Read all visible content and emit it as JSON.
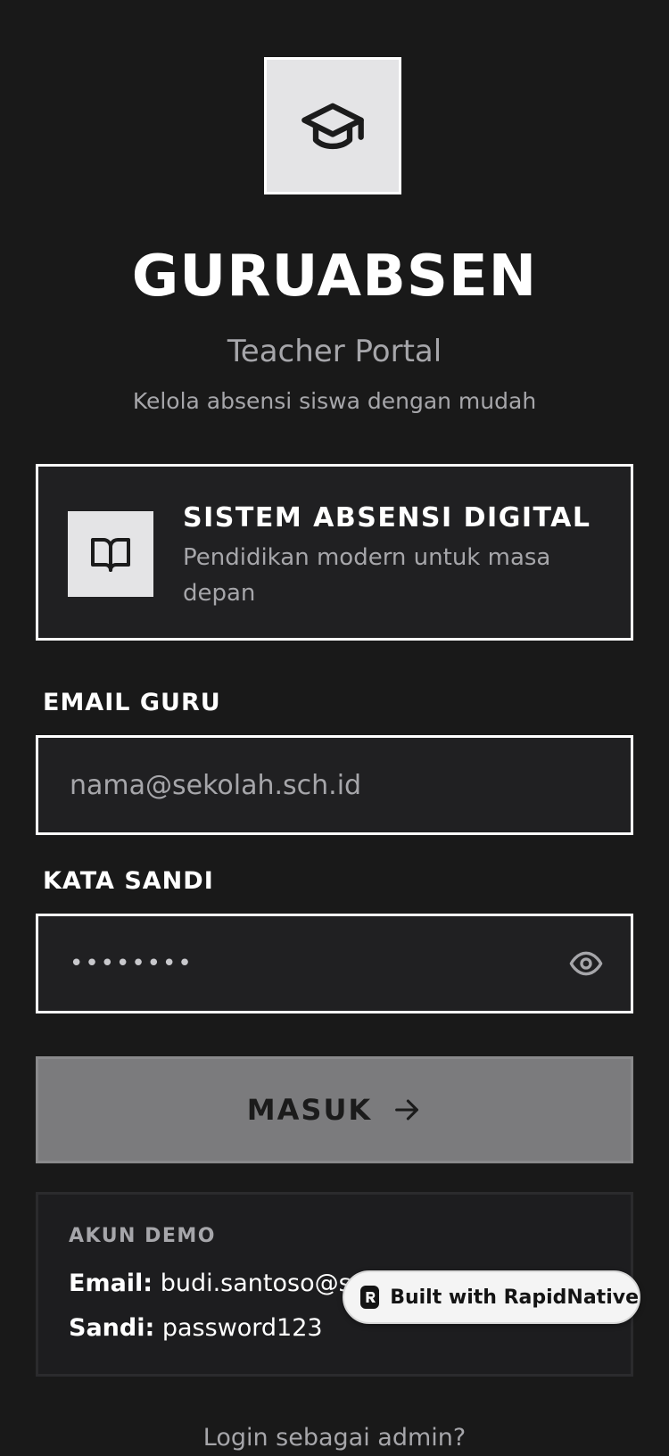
{
  "app": {
    "title": "GURUABSEN",
    "subtitle": "Teacher Portal",
    "tagline": "Kelola absensi siswa dengan mudah",
    "logo_icon": "graduation-cap-icon"
  },
  "feature": {
    "icon": "book-open-icon",
    "title": "SISTEM ABSENSI DIGITAL",
    "description": "Pendidikan modern untuk masa depan"
  },
  "form": {
    "email_label": "EMAIL GURU",
    "email_placeholder": "nama@sekolah.sch.id",
    "password_label": "KATA SANDI",
    "password_value": "••••••••",
    "password_toggle_icon": "eye-icon",
    "submit_label": "MASUK",
    "submit_icon": "arrow-right-icon"
  },
  "demo": {
    "heading": "AKUN DEMO",
    "email_label": "Email:",
    "email_value": "budi.santoso@se",
    "password_label": "Sandi:",
    "password_value": "password123"
  },
  "badge": {
    "label": "Built with RapidNative",
    "icon": "rapidnative-logo-icon"
  },
  "footer": {
    "admin_link": "Login sebagai admin?"
  },
  "colors": {
    "background": "#191919",
    "card": "#202022",
    "border": "#ffffff",
    "muted_text": "#a6a6aa",
    "button": "#7b7b7d",
    "icon_tile": "#e4e4e6"
  }
}
